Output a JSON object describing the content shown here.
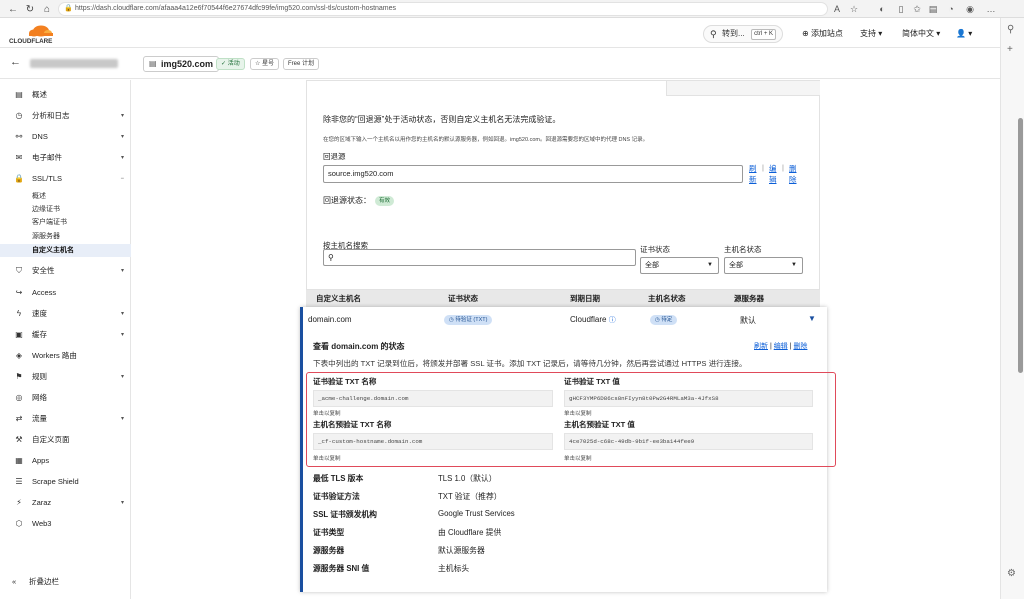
{
  "browser": {
    "url": "https://dash.cloudflare.com/afaaa4a12e6f70544f6e27674dfc99fe/img520.com/ssl-tls/custom-hostnames"
  },
  "topbar": {
    "logo_text": "CLOUDFLARE",
    "goto_label": "转到...",
    "goto_shortcut": "ctrl + K",
    "add_site": "添加站点",
    "support": "支持",
    "language": "简体中文"
  },
  "subbar": {
    "zone_name": "img520.com",
    "status_pill": "活动",
    "star_pill": "星号",
    "plan_pill": "Free 计划"
  },
  "sidebar": {
    "items": [
      {
        "label": "概述",
        "icon": "document-icon"
      },
      {
        "label": "分析和日志",
        "icon": "clock-icon"
      },
      {
        "label": "DNS",
        "icon": "network-icon"
      },
      {
        "label": "电子邮件",
        "icon": "mail-icon"
      },
      {
        "label": "SSL/TLS",
        "icon": "lock-icon"
      },
      {
        "label": "安全性",
        "icon": "shield-icon"
      },
      {
        "label": "Access",
        "icon": "access-icon"
      },
      {
        "label": "速度",
        "icon": "lightning-icon"
      },
      {
        "label": "缓存",
        "icon": "cache-icon"
      },
      {
        "label": "Workers 路由",
        "icon": "workers-icon"
      },
      {
        "label": "规则",
        "icon": "rules-icon"
      },
      {
        "label": "网络",
        "icon": "globe-icon"
      },
      {
        "label": "流量",
        "icon": "traffic-icon"
      },
      {
        "label": "自定义页面",
        "icon": "wrench-icon"
      },
      {
        "label": "Apps",
        "icon": "apps-icon"
      },
      {
        "label": "Scrape Shield",
        "icon": "scrape-icon"
      },
      {
        "label": "Zaraz",
        "icon": "zaraz-icon"
      },
      {
        "label": "Web3",
        "icon": "web3-icon"
      }
    ],
    "ssl_sub": [
      "概述",
      "边缘证书",
      "客户端证书",
      "源服务器",
      "自定义主机名"
    ],
    "collapse": "折叠边栏"
  },
  "fallback": {
    "intro": "除非您的“回退源”处于活动状态，否则自定义主机名无法完成验证。",
    "desc": "在您的区域下输入一个主机名以用作您的主机名的默认源服务器，例如回退。img520.com。回退源需要您的区域中的代理 DNS 记录。",
    "field_label": "回退源",
    "field_value": "source.img520.com",
    "act_refresh": "刷新",
    "act_edit": "编辑",
    "act_delete": "删除",
    "status_label": "回退源状态：",
    "status_badge": "有效"
  },
  "filters": {
    "search_label": "按主机名搜索",
    "cert_label": "证书状态",
    "cert_value": "全部",
    "host_label": "主机名状态",
    "host_value": "全部"
  },
  "table": {
    "headers": [
      "自定义主机名",
      "证书状态",
      "到期日期",
      "主机名状态",
      "源服务器"
    ],
    "row": {
      "hostname": "domain.com",
      "cert_status": "待验证 (TXT)",
      "expiry": "Cloudflare",
      "host_status": "待定",
      "origin": "默认"
    }
  },
  "detail": {
    "title": "查看 domain.com 的状态",
    "refresh": "刷新",
    "edit": "编辑",
    "delete": "删除",
    "desc": "下表中列出的 TXT 记录到位后，将颁发并部署 SSL 证书。添加 TXT 记录后，请等待几分钟，然后再尝试通过 HTTPS 进行连接。",
    "cert_txt_name_label": "证书验证 TXT 名称",
    "cert_txt_name": "_acme-challenge.domain.com",
    "cert_txt_value_label": "证书验证 TXT 值",
    "cert_txt_value": "gHCF3YMP6D86cs8nFIyyn8t0Pw2G4RMLaM3a-4JfxS8",
    "host_txt_name_label": "主机名预验证 TXT 名称",
    "host_txt_name": "_cf-custom-hostname.domain.com",
    "host_txt_value_label": "主机名预验证 TXT 值",
    "host_txt_value": "4ce7025d-c68c-49db-9b1f-ee3ba144fee9",
    "copy_hint": "单击以复制",
    "props": [
      {
        "k": "最低 TLS 版本",
        "v": "TLS 1.0（默认）"
      },
      {
        "k": "证书验证方法",
        "v": "TXT 验证（推荐）"
      },
      {
        "k": "SSL 证书颁发机构",
        "v": "Google Trust Services"
      },
      {
        "k": "证书类型",
        "v": "由 Cloudflare 提供"
      },
      {
        "k": "源服务器",
        "v": "默认源服务器"
      },
      {
        "k": "源服务器 SNI 值",
        "v": "主机标头"
      }
    ]
  },
  "colors": {
    "accent": "#1a4fa0",
    "highlight": "#e04a5a",
    "cf_orange": "#f38020"
  }
}
